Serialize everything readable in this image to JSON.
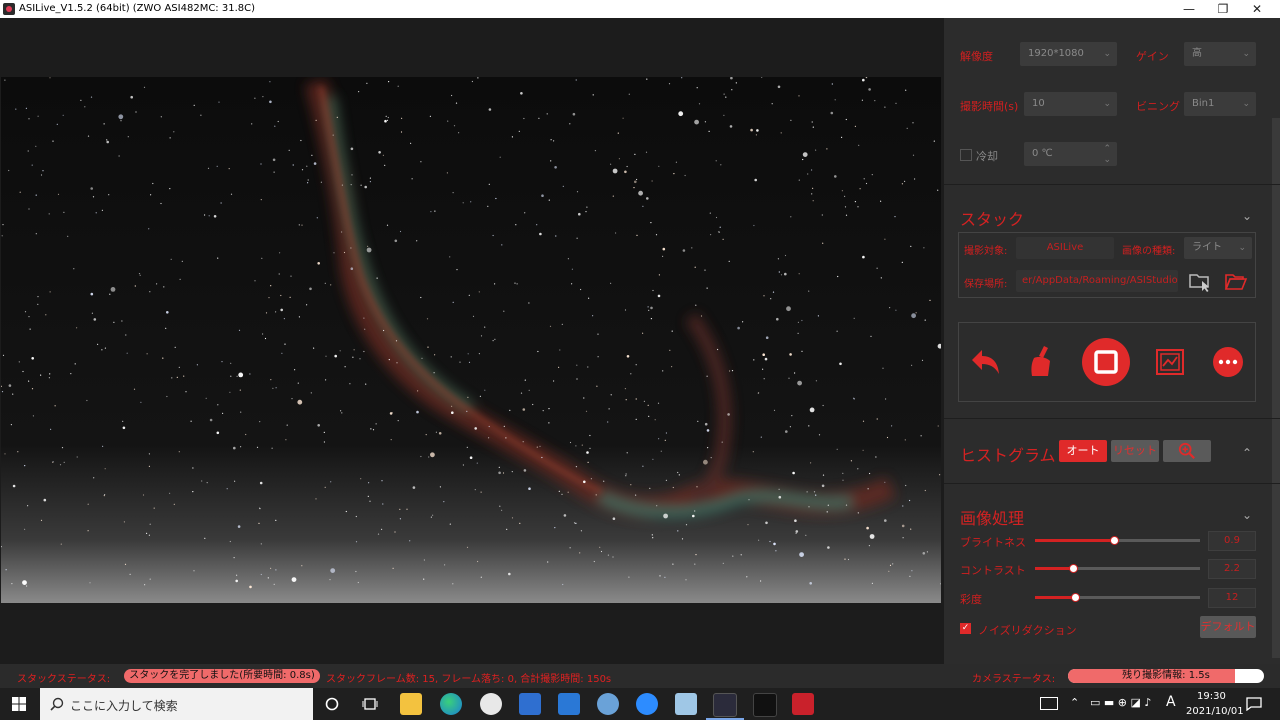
{
  "window": {
    "title": "ASILive_V1.5.2 (64bit)  (ZWO ASI482MC: 31.8C)",
    "minimize_glyph": "—",
    "maximize_glyph": "❐",
    "close_glyph": "✕"
  },
  "camera": {
    "resolution_label": "解像度",
    "resolution_value": "1920*1080",
    "gain_label": "ゲイン",
    "gain_value": "高",
    "exposure_label": "撮影時間(s)",
    "exposure_value": "10",
    "binning_label": "ビニング",
    "binning_value": "Bin1",
    "cooling_label": "冷却",
    "cooling_value": "0 ℃"
  },
  "stack": {
    "header": "スタック",
    "target_label": "撮影対象:",
    "target_value": "ASILive",
    "image_type_label": "画像の種類:",
    "image_type_value": "ライト",
    "save_path_label": "保存場所:",
    "save_path_value": "er/AppData/Roaming/ASIStudio"
  },
  "histogram": {
    "header": "ヒストグラム",
    "auto_label": "オート",
    "reset_label": "リセット"
  },
  "processing": {
    "header": "画像処理",
    "brightness_label": "ブライトネス",
    "brightness_value": "0.9",
    "brightness_level": 0.48,
    "contrast_label": "コントラスト",
    "contrast_value": "2.2",
    "contrast_level": 0.23,
    "saturation_label": "彩度",
    "saturation_value": "12",
    "saturation_level": 0.24,
    "noise_label": "ノイズリダクション",
    "default_label": "デフォルト"
  },
  "status": {
    "stack_status_label": "スタックステータス:",
    "stack_status_value": "スタックを完了しました(所要時間: 0.8s)",
    "stack_info": "スタックフレーム数: 15, フレーム落ち: 0, 合計撮影時間: 150s",
    "camera_status_label": "カメラステータス:",
    "camera_status_value": "残り撮影情報: 1.5s",
    "remaining_level": 0.85
  },
  "taskbar": {
    "search_placeholder": "ここに入力して検索",
    "time": "19:30",
    "date": "2021/10/01",
    "ime": "A"
  },
  "colors": {
    "accent_red": "#e02a2a",
    "panel_bg": "#2c2c2c",
    "sky_bg": "#0d0d0d"
  }
}
